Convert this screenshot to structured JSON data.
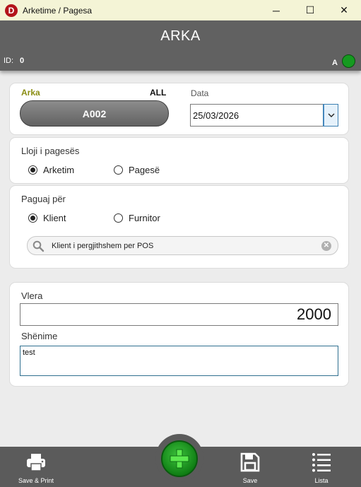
{
  "window": {
    "title": "Arketime / Pagesa",
    "logo_letter": "D",
    "controls": {
      "minimize": "─",
      "maximize": "☐",
      "close": "✕"
    }
  },
  "header": {
    "title": "ARKA",
    "id_label": "ID:",
    "id_value": "0",
    "status_letter": "A",
    "status_color": "#159a20"
  },
  "cash_register": {
    "label": "Arka",
    "currency": "ALL",
    "selected": "A002"
  },
  "date": {
    "label": "Data",
    "value": "25/03/2026"
  },
  "payment_type": {
    "label": "Lloji i pagesës",
    "options": [
      {
        "label": "Arketim",
        "selected": true
      },
      {
        "label": "Pagesë",
        "selected": false
      }
    ]
  },
  "pay_for": {
    "label": "Paguaj për",
    "options": [
      {
        "label": "Klient",
        "selected": true
      },
      {
        "label": "Furnitor",
        "selected": false
      }
    ],
    "search_value": "Klient i pergjithshem per POS"
  },
  "amount": {
    "label": "Vlera",
    "value": "2000"
  },
  "note": {
    "label": "Shënime",
    "value": "test"
  },
  "bottom_bar": {
    "save_print": {
      "label": "Save & Print",
      "icon": "printer-icon"
    },
    "add": {
      "icon": "plus-icon"
    },
    "save": {
      "label": "Save",
      "icon": "floppy-disk-icon"
    },
    "list": {
      "label": "Lista",
      "icon": "list-icon"
    }
  },
  "colors": {
    "header_bg": "#616161",
    "accent_label": "#8a8d12",
    "fab_green": "#1f9e24",
    "titlebar_bg": "#f4f4d6"
  }
}
